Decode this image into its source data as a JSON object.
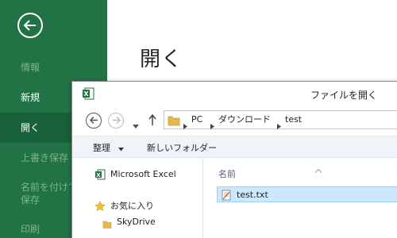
{
  "backstage": {
    "heading": "開く",
    "nav": [
      {
        "label": "情報",
        "state": "disabled"
      },
      {
        "label": "新規",
        "state": "normal"
      },
      {
        "label": "開く",
        "state": "selected"
      },
      {
        "label": "上書き保存",
        "state": "disabled"
      },
      {
        "label": "名前を付けて\n保存",
        "state": "disabled"
      },
      {
        "label": "印刷",
        "state": "disabled"
      }
    ],
    "colors": {
      "green": "#217346",
      "selected": "#19613a",
      "disabled_text": "#7fb48f"
    }
  },
  "dialog": {
    "title": "ファイルを開く",
    "breadcrumb": [
      "PC",
      "ダウンロード",
      "test"
    ],
    "toolbar": {
      "organize": "整理",
      "new_folder": "新しいフォルダー"
    },
    "nav_pane": {
      "items": [
        {
          "label": "Microsoft Excel",
          "icon": "excel-icon"
        },
        {
          "label": "お気に入り",
          "icon": "star-icon"
        },
        {
          "label": "SkyDrive",
          "icon": "folder-icon"
        }
      ]
    },
    "file_list": {
      "column_name": "名前",
      "files": [
        {
          "name": "test.txt",
          "icon": "text-file-icon",
          "selected": true
        }
      ]
    }
  }
}
